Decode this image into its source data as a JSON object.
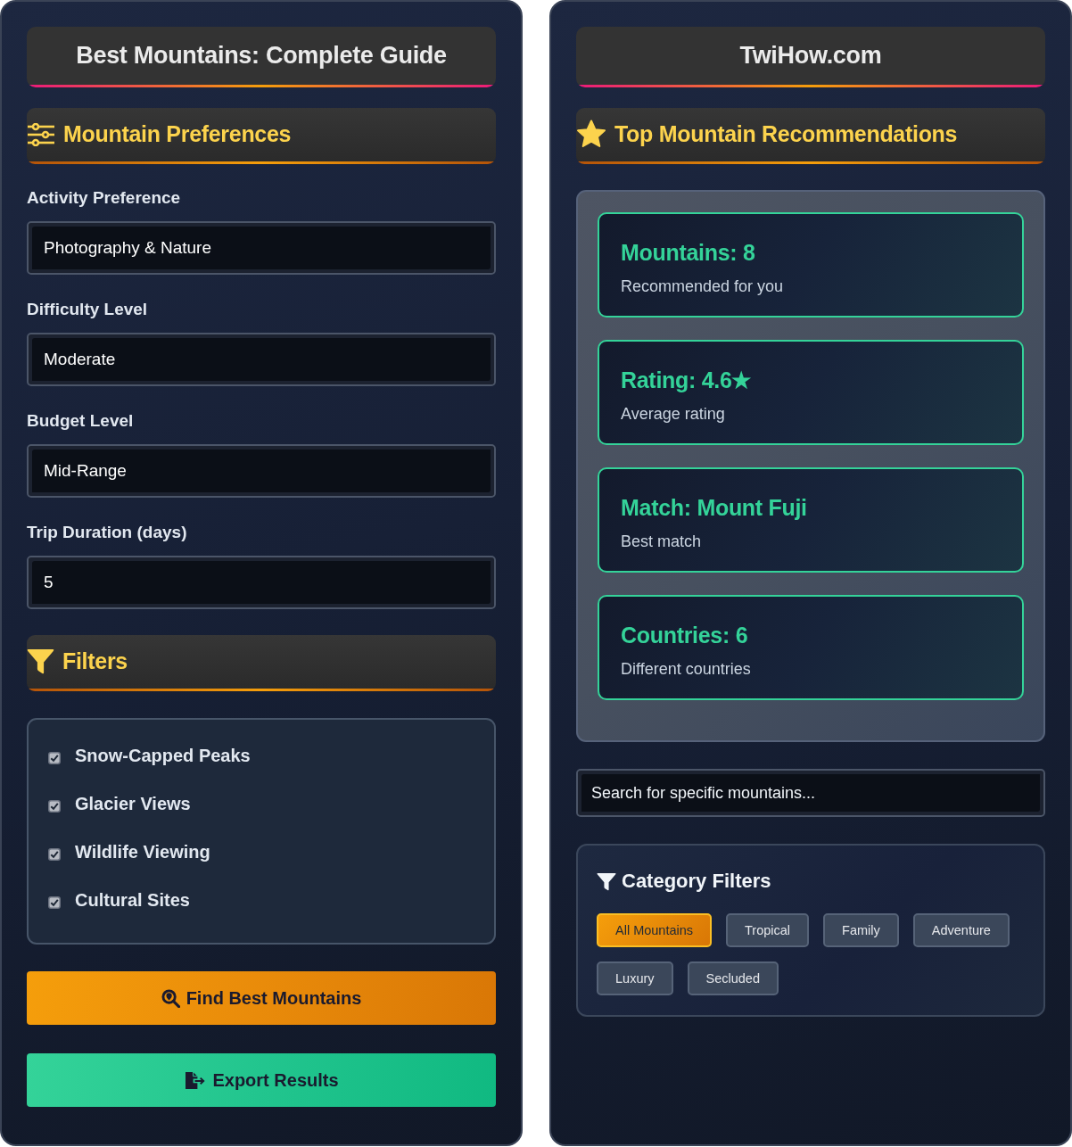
{
  "left_panel": {
    "header": {
      "title": "Best Mountains: Complete Guide"
    },
    "preferences": {
      "heading": "Mountain Preferences",
      "fields": [
        {
          "label": "Activity Preference",
          "value": "Photography & Nature"
        },
        {
          "label": "Difficulty Level",
          "value": "Moderate"
        },
        {
          "label": "Budget Level",
          "value": "Mid-Range"
        },
        {
          "label": "Trip Duration (days)",
          "value": "5"
        }
      ]
    },
    "filters": {
      "heading": "Filters",
      "options": [
        {
          "label": "Snow-Capped Peaks",
          "checked": true
        },
        {
          "label": "Glacier Views",
          "checked": true
        },
        {
          "label": "Wildlife Viewing",
          "checked": true
        },
        {
          "label": "Cultural Sites",
          "checked": true
        }
      ]
    },
    "buttons": [
      {
        "label": "Find Best Mountains",
        "kind": "primary"
      },
      {
        "label": "Export Results",
        "kind": "success"
      }
    ]
  },
  "right_panel": {
    "header": {
      "title": "TwiHow.com"
    },
    "recommendations": {
      "heading": "Top Mountain Recommendations",
      "stats": [
        {
          "value": "Mountains: 8",
          "caption": "Recommended for you"
        },
        {
          "value": "Rating: 4.6★",
          "caption": "Average rating"
        },
        {
          "value": "Match: Mount Fuji",
          "caption": "Best match"
        },
        {
          "value": "Countries: 6",
          "caption": "Different countries"
        }
      ]
    },
    "search": {
      "placeholder": "Search for specific mountains..."
    },
    "category_filters": {
      "heading": "Category Filters",
      "chips": [
        {
          "label": "All Mountains",
          "selected": true
        },
        {
          "label": "Tropical",
          "selected": false
        },
        {
          "label": "Family",
          "selected": false
        },
        {
          "label": "Adventure",
          "selected": false
        },
        {
          "label": "Luxury",
          "selected": false
        },
        {
          "label": "Secluded",
          "selected": false
        }
      ]
    }
  }
}
